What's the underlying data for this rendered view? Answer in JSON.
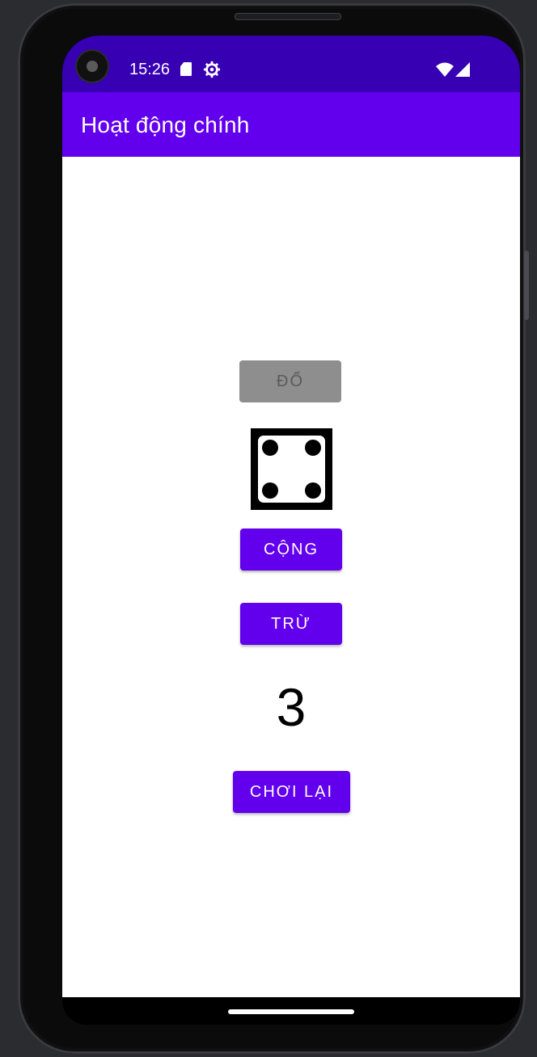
{
  "status_bar": {
    "time": "15:26",
    "icons": [
      "sd-card-icon",
      "gear-icon",
      "wifi-icon",
      "cellular-signal-icon"
    ]
  },
  "app_bar": {
    "title": "Hoạt động chính",
    "color": "#6200ee",
    "status_color": "#3700b3"
  },
  "main": {
    "roll_button": {
      "label": "ĐỔ",
      "enabled": false
    },
    "dice": {
      "face_value": 4,
      "icon": "dice-four-icon"
    },
    "add_button": {
      "label": "CỘNG"
    },
    "subtract_button": {
      "label": "TRỪ"
    },
    "score": "3",
    "replay_button": {
      "label": "CHƠI LẠI"
    }
  },
  "colors": {
    "accent": "#6200ee",
    "disabled_button": "#8e8e8e",
    "background": "#ffffff"
  }
}
